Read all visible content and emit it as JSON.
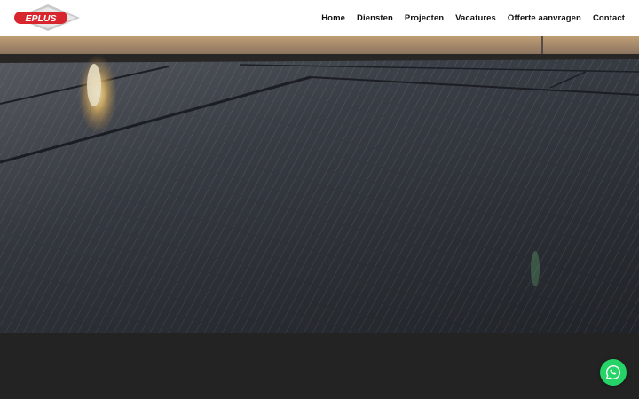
{
  "header": {
    "logo_text": "EPLUS",
    "nav": [
      {
        "label": "Home"
      },
      {
        "label": "Diensten"
      },
      {
        "label": "Projecten"
      },
      {
        "label": "Vacatures"
      },
      {
        "label": "Offerte aanvragen"
      },
      {
        "label": "Contact"
      }
    ]
  },
  "hero": {
    "image": "solar-panels-at-sunset"
  },
  "icons": {
    "whatsapp": "whatsapp-icon"
  },
  "colors": {
    "brand_red": "#d7262d",
    "whatsapp_green": "#25d366",
    "footer_bg": "#232323"
  }
}
